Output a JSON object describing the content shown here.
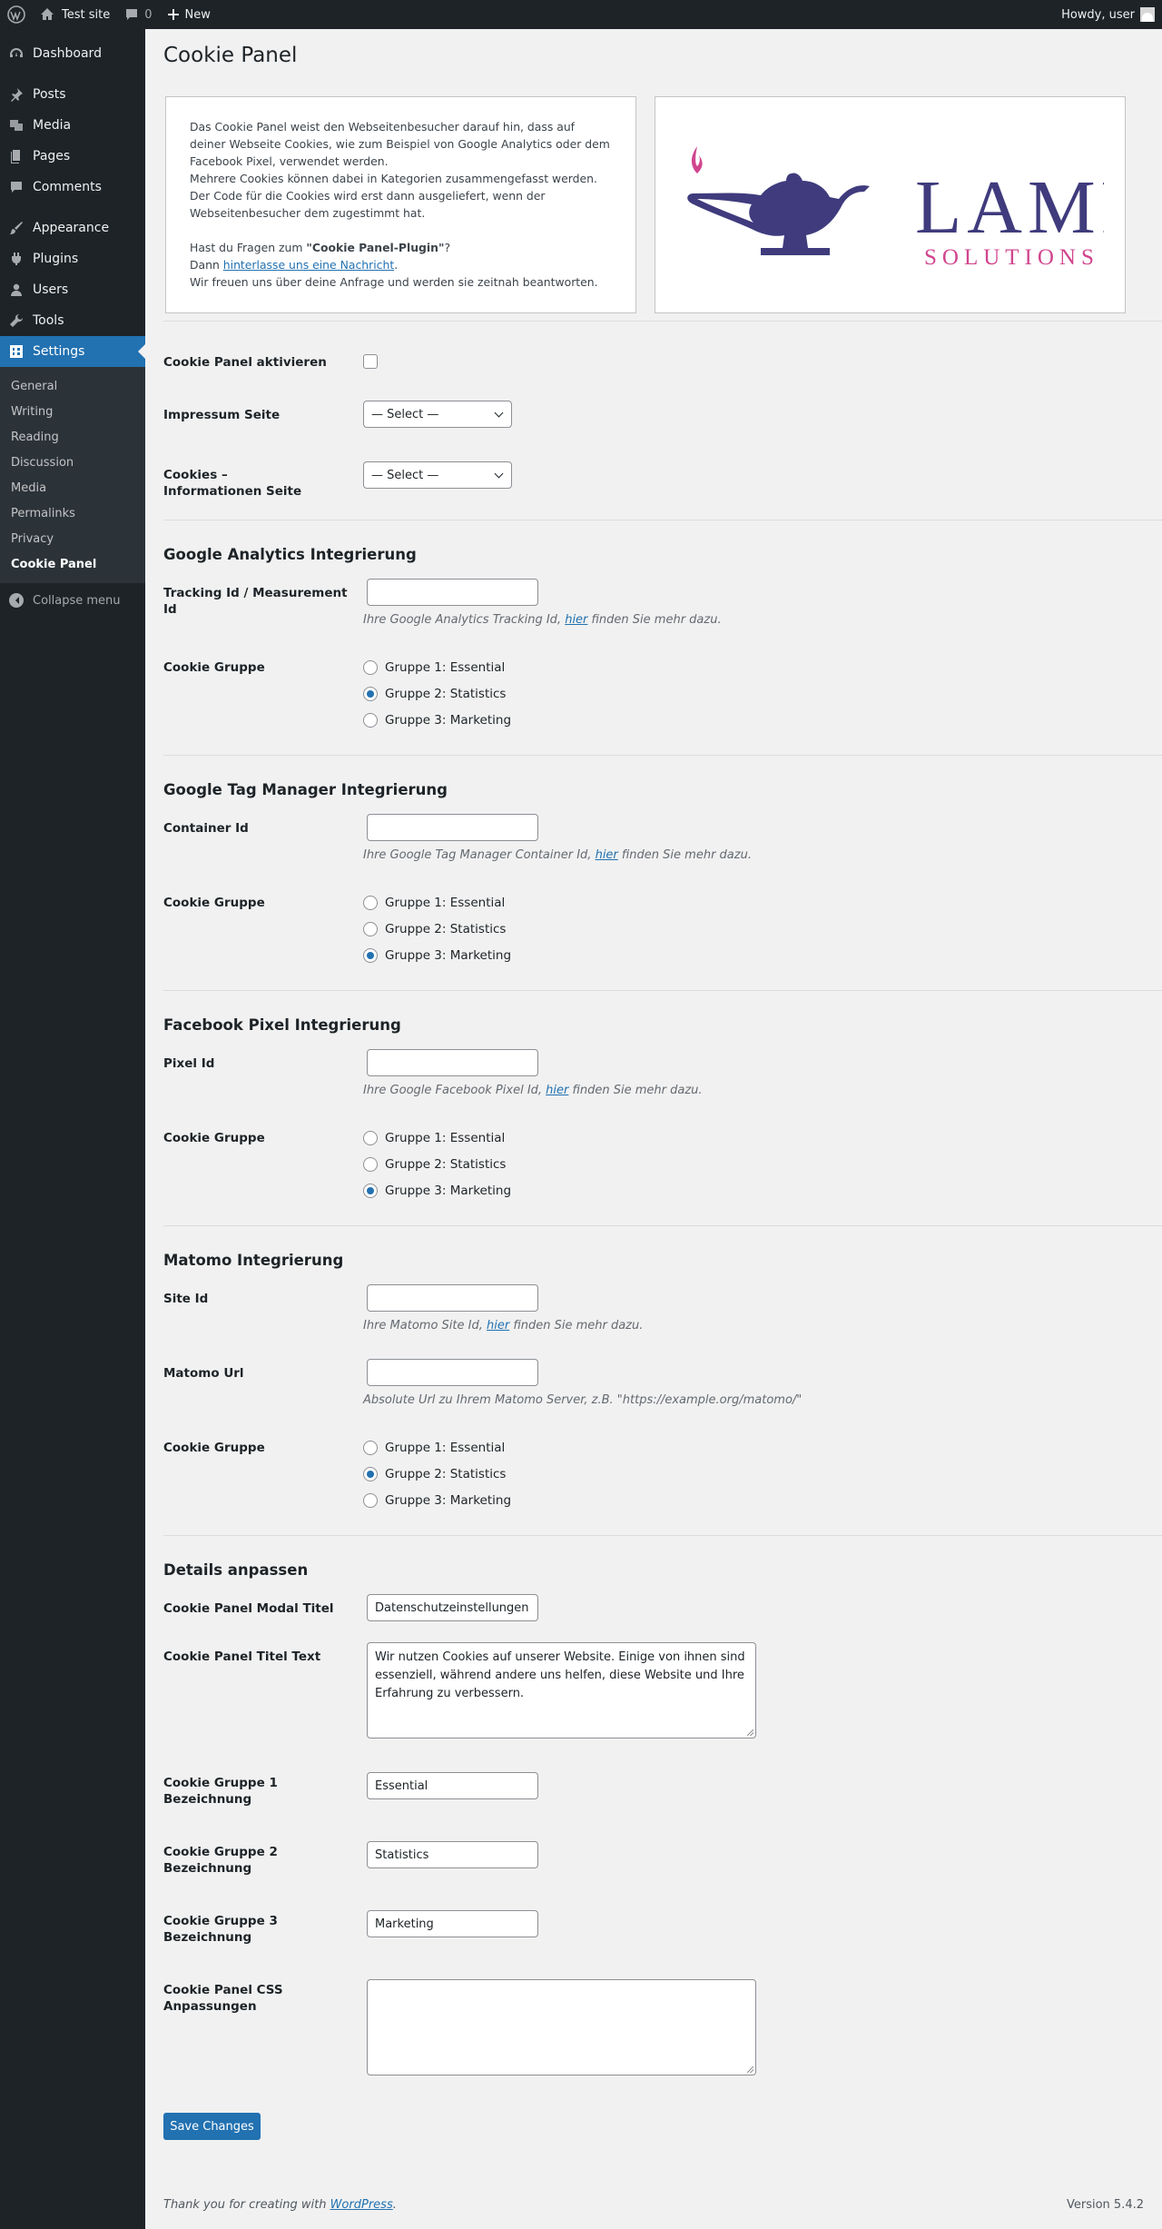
{
  "adminbar": {
    "site_name": "Test site",
    "comments_count": "0",
    "new_label": "New",
    "howdy": "Howdy, user"
  },
  "sidebar": {
    "items": [
      {
        "label": "Dashboard",
        "icon": "dashboard-icon"
      },
      {
        "label": "Posts",
        "icon": "pin-icon"
      },
      {
        "label": "Media",
        "icon": "media-icon"
      },
      {
        "label": "Pages",
        "icon": "page-icon"
      },
      {
        "label": "Comments",
        "icon": "comment-icon"
      },
      {
        "label": "Appearance",
        "icon": "brush-icon"
      },
      {
        "label": "Plugins",
        "icon": "plug-icon"
      },
      {
        "label": "Users",
        "icon": "user-icon"
      },
      {
        "label": "Tools",
        "icon": "wrench-icon"
      },
      {
        "label": "Settings",
        "icon": "settings-icon"
      }
    ],
    "submenu": [
      "General",
      "Writing",
      "Reading",
      "Discussion",
      "Media",
      "Permalinks",
      "Privacy",
      "Cookie Panel"
    ],
    "collapse": "Collapse menu"
  },
  "page": {
    "title": "Cookie Panel",
    "intro": {
      "p1": "Das Cookie Panel weist den Webseitenbesucher darauf hin, dass auf deiner Webseite Cookies, wie zum Beispiel von Google Analytics oder dem Facebook Pixel, verwendet werden.",
      "p2": "Mehrere Cookies können dabei in Kategorien zusammengefasst werden.",
      "p3": "Der Code für die Cookies wird erst dann ausgeliefert, wenn der Webseitenbesucher dem zugestimmt hat.",
      "q_prefix": "Hast du Fragen zum ",
      "q_bold": "\"Cookie Panel-Plugin\"",
      "q_suffix": "?",
      "dann": "Dann ",
      "link": "hinterlasse uns eine Nachricht",
      "dot": ".",
      "thanks": "Wir freuen uns über deine Anfrage und werden sie zeitnah beantworten."
    },
    "logo": {
      "word1": "LAMP",
      "word2": "SOLUTIONS"
    }
  },
  "general": {
    "activate_label": "Cookie Panel aktivieren",
    "impressum_label": "Impressum Seite",
    "impressum_value": "— Select —",
    "cookies_info_label": "Cookies – Informationen Seite",
    "cookies_info_value": "— Select —"
  },
  "ga": {
    "title": "Google Analytics Integrierung",
    "id_label": "Tracking Id / Measurement Id",
    "id_value": "",
    "desc_pre": "Ihre Google Analytics Tracking Id, ",
    "desc_link": "hier",
    "desc_post": " finden Sie mehr dazu.",
    "group_label": "Cookie Gruppe",
    "selected": 1
  },
  "gtm": {
    "title": "Google Tag Manager Integrierung",
    "id_label": "Container Id",
    "id_value": "",
    "desc_pre": "Ihre Google Tag Manager Container Id, ",
    "desc_link": "hier",
    "desc_post": " finden Sie mehr dazu.",
    "group_label": "Cookie Gruppe",
    "selected": 2
  },
  "fb": {
    "title": "Facebook Pixel Integrierung",
    "id_label": "Pixel Id",
    "id_value": "",
    "desc_pre": "Ihre Google Facebook Pixel Id, ",
    "desc_link": "hier",
    "desc_post": " finden Sie mehr dazu.",
    "group_label": "Cookie Gruppe",
    "selected": 2
  },
  "matomo": {
    "title": "Matomo Integrierung",
    "id_label": "Site Id",
    "id_value": "",
    "desc_pre": "Ihre Matomo Site Id, ",
    "desc_link": "hier",
    "desc_post": " finden Sie mehr dazu.",
    "url_label": "Matomo Url",
    "url_value": "",
    "url_desc": "Absolute Url zu Ihrem Matomo Server, z.B. \"https://example.org/matomo/\"",
    "group_label": "Cookie Gruppe",
    "selected": 1
  },
  "groups": [
    "Gruppe 1: Essential",
    "Gruppe 2: Statistics",
    "Gruppe 3: Marketing"
  ],
  "details": {
    "title": "Details anpassen",
    "modal_title_label": "Cookie Panel Modal Titel",
    "modal_title_value": "Datenschutzeinstellungen",
    "title_text_label": "Cookie Panel Titel Text",
    "title_text_value": "Wir nutzen Cookies auf unserer Website. Einige von ihnen sind essenziell, während andere uns helfen, diese Website und Ihre Erfahrung zu verbessern.",
    "g1_label": "Cookie Gruppe 1 Bezeichnung",
    "g1_value": "Essential",
    "g2_label": "Cookie Gruppe 2 Bezeichnung",
    "g2_value": "Statistics",
    "g3_label": "Cookie Gruppe 3 Bezeichnung",
    "g3_value": "Marketing",
    "css_label": "Cookie Panel CSS Anpassungen",
    "css_value": ""
  },
  "save_label": "Save Changes",
  "footer": {
    "thanks_pre": "Thank you for creating with ",
    "wp_link": "WordPress",
    "thanks_post": ".",
    "version": "Version 5.4.2"
  },
  "colors": {
    "accent": "#2271b1",
    "adminbar": "#1d2327",
    "logo_blue": "#3f3b7d",
    "logo_pink": "#d1458e"
  }
}
